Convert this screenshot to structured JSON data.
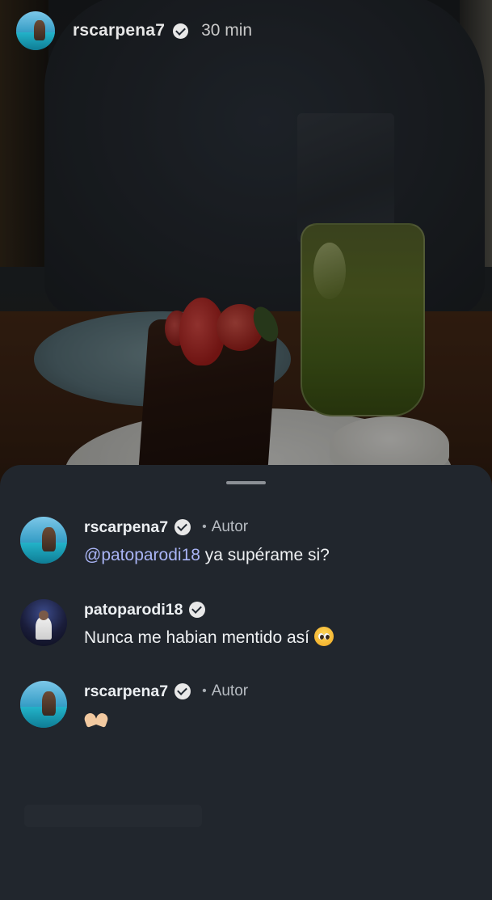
{
  "story": {
    "username": "rscarpena7",
    "time": "30 min",
    "avatar_icon": "profile-photo-beach",
    "verified_icon": "verified-badge-icon"
  },
  "comments": [
    {
      "username": "rscarpena7",
      "verified": true,
      "role": "Autor",
      "mention": "@patoparodi18",
      "text": " ya supérame si?",
      "avatar_icon": "profile-photo-beach"
    },
    {
      "username": "patoparodi18",
      "verified": true,
      "role": "",
      "text": "Nunca me habian mentido así",
      "emoji": "pleading-face-icon",
      "avatar_icon": "profile-photo-night"
    },
    {
      "username": "rscarpena7",
      "verified": true,
      "role": "Autor",
      "text": "",
      "emoji": "heart-hands-icon",
      "avatar_icon": "profile-photo-beach"
    }
  ],
  "colors": {
    "sheet_bg": "#21262d",
    "mention": "#a9b4f5",
    "text_primary": "#eef0f2",
    "text_secondary": "#b7bcc2"
  }
}
